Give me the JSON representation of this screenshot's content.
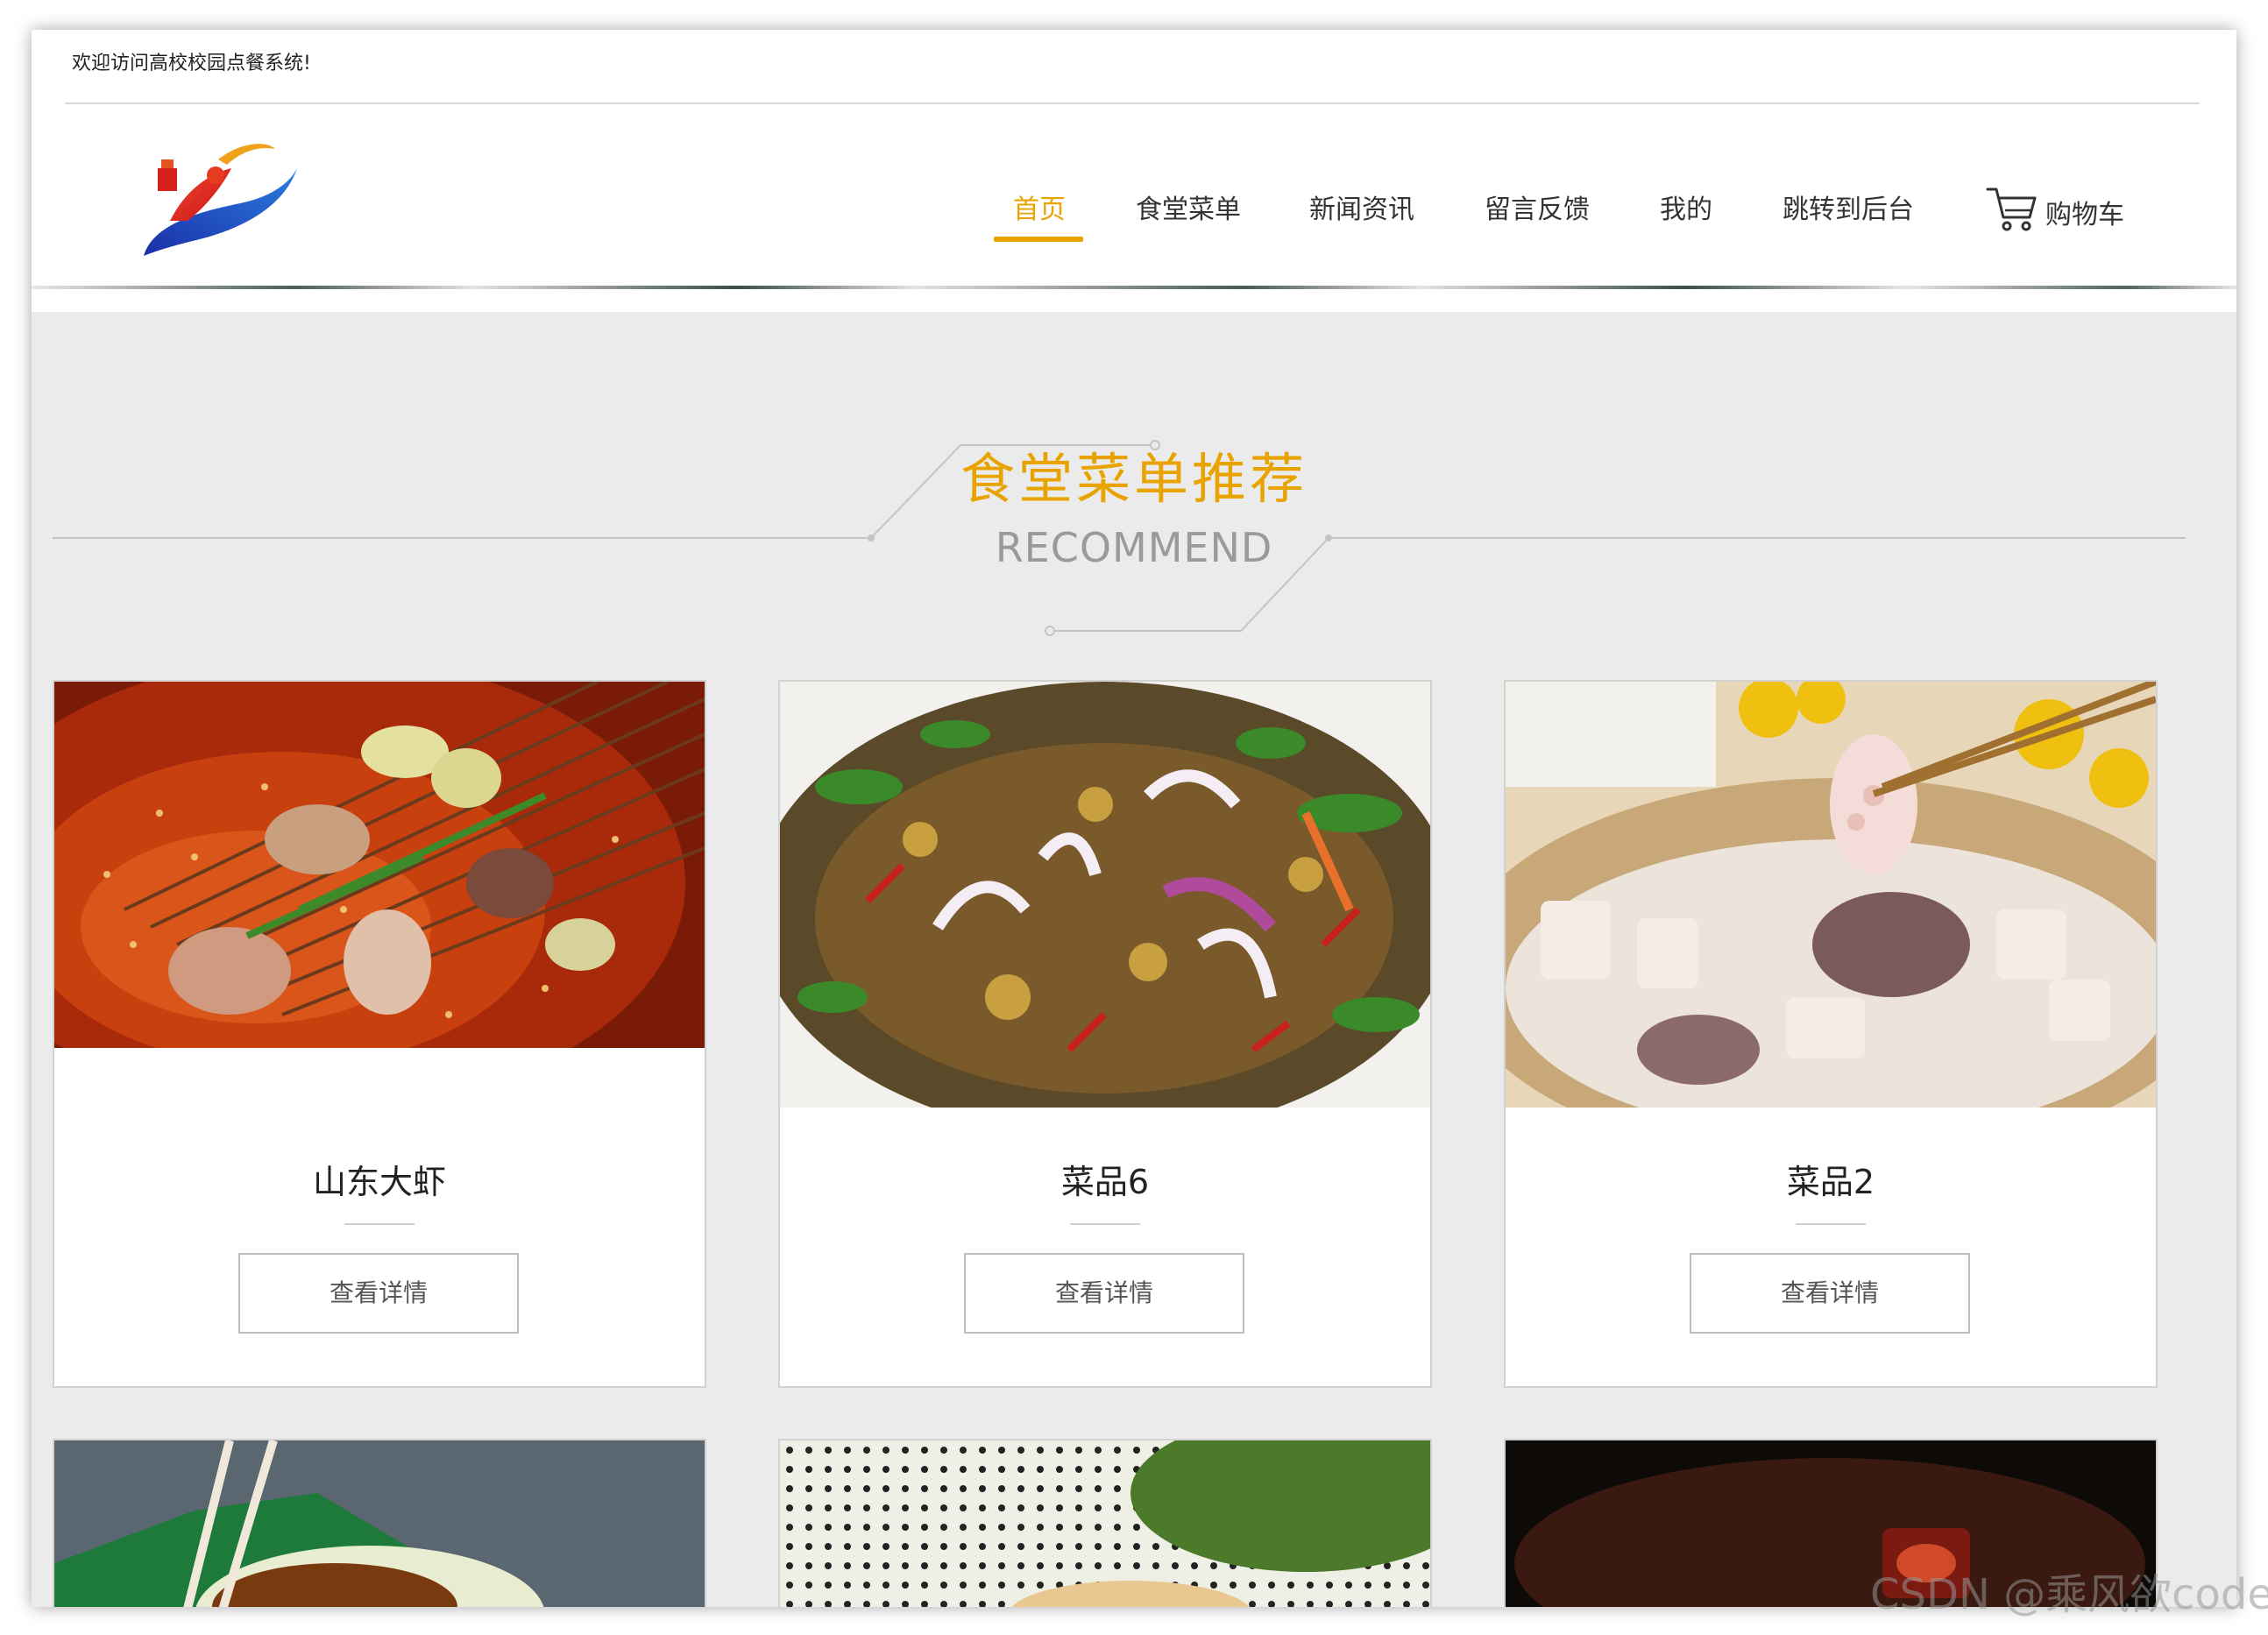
{
  "welcome": "欢迎访问高校校园点餐系统!",
  "nav": {
    "items": [
      {
        "label": "首页",
        "active": true
      },
      {
        "label": "食堂菜单"
      },
      {
        "label": "新闻资讯"
      },
      {
        "label": "留言反馈"
      },
      {
        "label": "我的"
      },
      {
        "label": "跳转到后台"
      }
    ],
    "cart_label": "购物车",
    "accent": "#e8a300"
  },
  "section": {
    "title": "食堂菜单推荐",
    "subtitle": "RECOMMEND"
  },
  "dishes": [
    {
      "name": "山东大虾",
      "button": "查看详情",
      "image": "spicy-skewers-hotpot"
    },
    {
      "name": "菜品6",
      "button": "查看详情",
      "image": "stir-fried-vegetables"
    },
    {
      "name": "菜品2",
      "button": "查看详情",
      "image": "lotus-root-stew"
    }
  ],
  "watermark": "CSDN @乘风欲code"
}
